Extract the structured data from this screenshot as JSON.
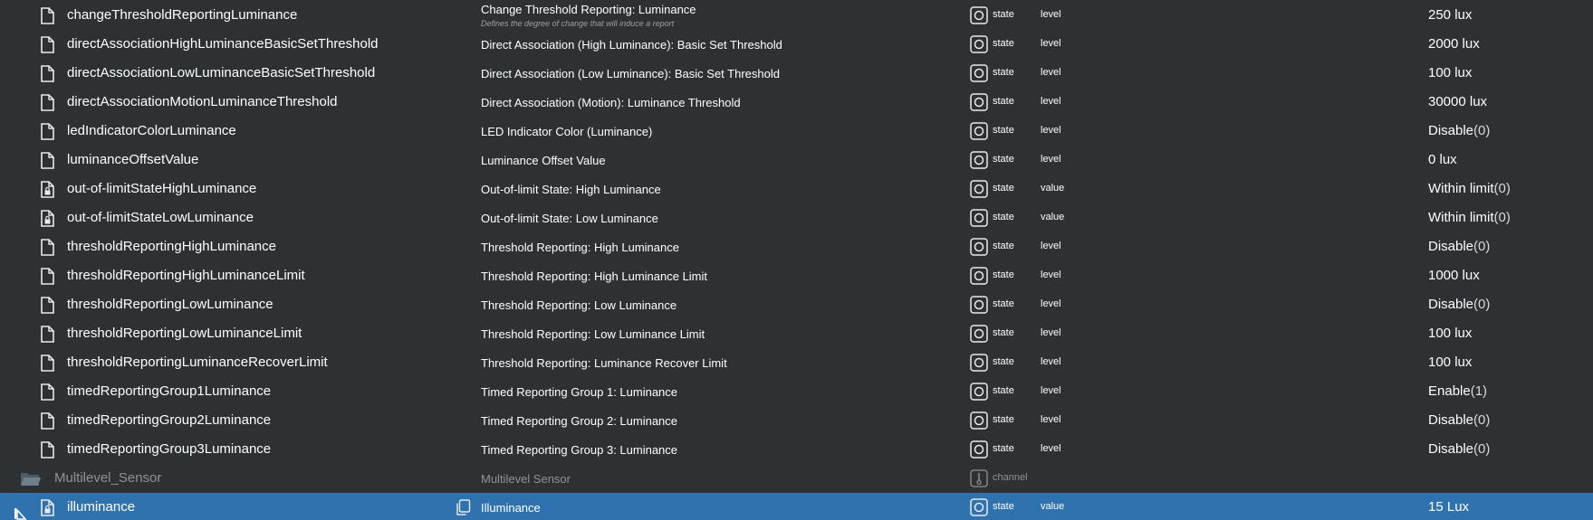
{
  "colors": {
    "background": "#2d3133",
    "selected_row": "#3072ad",
    "folder_text": "#8d9396",
    "icon": "#e8eaeb"
  },
  "rows": [
    {
      "id": "changeThresholdReportingLuminance",
      "name": "Change Threshold Reporting: Luminance",
      "desc": "Defines the degree of change that will induce a report",
      "type": "state",
      "role": "level",
      "value": "250 lux",
      "value_extra": "",
      "icon": "file-icon"
    },
    {
      "id": "directAssociationHighLuminanceBasicSetThreshold",
      "name": "Direct Association (High Luminance): Basic Set Threshold",
      "desc": "",
      "type": "state",
      "role": "level",
      "value": "2000 lux",
      "value_extra": "",
      "icon": "file-icon"
    },
    {
      "id": "directAssociationLowLuminanceBasicSetThreshold",
      "name": "Direct Association (Low Luminance): Basic Set Threshold",
      "desc": "",
      "type": "state",
      "role": "level",
      "value": "100 lux",
      "value_extra": "",
      "icon": "file-icon"
    },
    {
      "id": "directAssociationMotionLuminanceThreshold",
      "name": "Direct Association (Motion): Luminance Threshold",
      "desc": "",
      "type": "state",
      "role": "level",
      "value": "30000 lux",
      "value_extra": "",
      "icon": "file-icon"
    },
    {
      "id": "ledIndicatorColorLuminance",
      "name": "LED Indicator Color (Luminance)",
      "desc": "",
      "type": "state",
      "role": "level",
      "value": "Disable",
      "value_extra": "(0)",
      "icon": "file-icon"
    },
    {
      "id": "luminanceOffsetValue",
      "name": "Luminance Offset Value",
      "desc": "",
      "type": "state",
      "role": "level",
      "value": "0 lux",
      "value_extra": "",
      "icon": "file-icon"
    },
    {
      "id": "out-of-limitStateHighLuminance",
      "name": "Out-of-limit State: High Luminance",
      "desc": "",
      "type": "state",
      "role": "value",
      "value": "Within limit",
      "value_extra": "(0)",
      "icon": "locked-file-icon"
    },
    {
      "id": "out-of-limitStateLowLuminance",
      "name": "Out-of-limit State: Low Luminance",
      "desc": "",
      "type": "state",
      "role": "value",
      "value": "Within limit",
      "value_extra": "(0)",
      "icon": "locked-file-icon"
    },
    {
      "id": "thresholdReportingHighLuminance",
      "name": "Threshold Reporting: High Luminance",
      "desc": "",
      "type": "state",
      "role": "level",
      "value": "Disable",
      "value_extra": "(0)",
      "icon": "file-icon"
    },
    {
      "id": "thresholdReportingHighLuminanceLimit",
      "name": "Threshold Reporting: High Luminance Limit",
      "desc": "",
      "type": "state",
      "role": "level",
      "value": "1000 lux",
      "value_extra": "",
      "icon": "file-icon"
    },
    {
      "id": "thresholdReportingLowLuminance",
      "name": "Threshold Reporting: Low Luminance",
      "desc": "",
      "type": "state",
      "role": "level",
      "value": "Disable",
      "value_extra": "(0)",
      "icon": "file-icon"
    },
    {
      "id": "thresholdReportingLowLuminanceLimit",
      "name": "Threshold Reporting: Low Luminance Limit",
      "desc": "",
      "type": "state",
      "role": "level",
      "value": "100 lux",
      "value_extra": "",
      "icon": "file-icon"
    },
    {
      "id": "thresholdReportingLuminanceRecoverLimit",
      "name": "Threshold Reporting: Luminance Recover Limit",
      "desc": "",
      "type": "state",
      "role": "level",
      "value": "100 lux",
      "value_extra": "",
      "icon": "file-icon"
    },
    {
      "id": "timedReportingGroup1Luminance",
      "name": "Timed Reporting Group 1: Luminance",
      "desc": "",
      "type": "state",
      "role": "level",
      "value": "Enable",
      "value_extra": "(1)",
      "icon": "file-icon"
    },
    {
      "id": "timedReportingGroup2Luminance",
      "name": "Timed Reporting Group 2: Luminance",
      "desc": "",
      "type": "state",
      "role": "level",
      "value": "Disable",
      "value_extra": "(0)",
      "icon": "file-icon"
    },
    {
      "id": "timedReportingGroup3Luminance",
      "name": "Timed Reporting Group 3: Luminance",
      "desc": "",
      "type": "state",
      "role": "level",
      "value": "Disable",
      "value_extra": "(0)",
      "icon": "file-icon"
    },
    {
      "id": "Multilevel_Sensor",
      "name": "Multilevel Sensor",
      "desc": "",
      "type": "channel",
      "role": "",
      "value": "",
      "value_extra": "",
      "icon": "folder-icon",
      "folder": true
    },
    {
      "id": "illuminance",
      "name": "Illuminance",
      "desc": "",
      "type": "state",
      "role": "value",
      "value": "15 Lux",
      "value_extra": "",
      "icon": "locked-file-icon",
      "selected": true
    }
  ]
}
